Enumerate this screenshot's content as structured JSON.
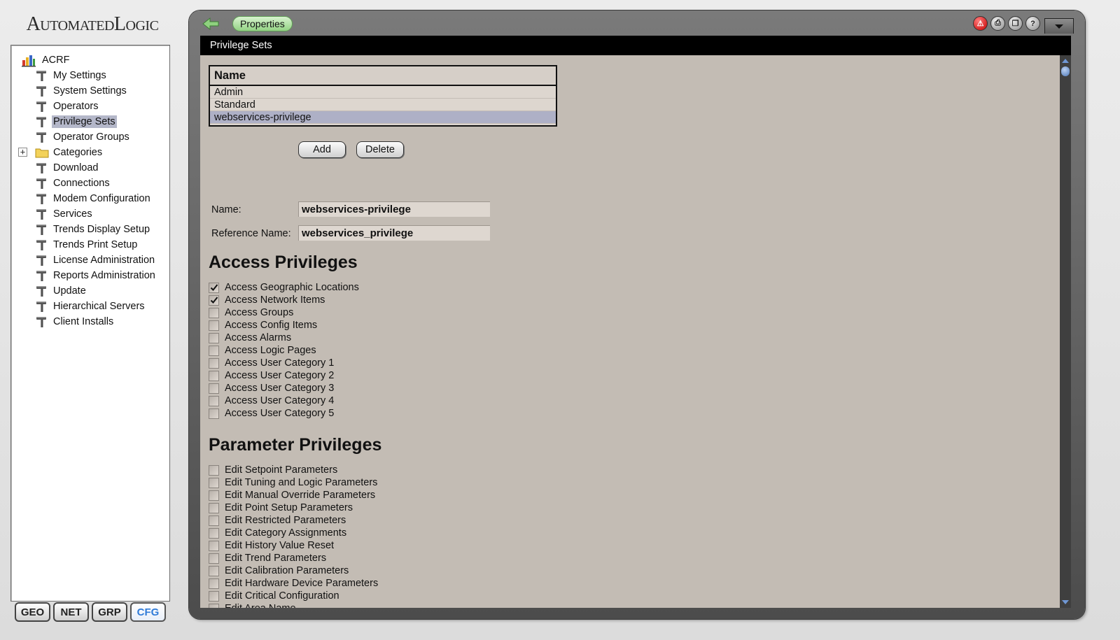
{
  "logo": "AutomatedLogic",
  "tree": {
    "root": "ACRF",
    "items": [
      {
        "label": "My Settings"
      },
      {
        "label": "System Settings"
      },
      {
        "label": "Operators"
      },
      {
        "label": "Privilege Sets",
        "selected": true
      },
      {
        "label": "Operator Groups"
      },
      {
        "label": "Categories",
        "folder": true,
        "expandable": true
      },
      {
        "label": "Download"
      },
      {
        "label": "Connections"
      },
      {
        "label": "Modem Configuration"
      },
      {
        "label": "Services"
      },
      {
        "label": "Trends Display Setup"
      },
      {
        "label": "Trends Print Setup"
      },
      {
        "label": "License Administration"
      },
      {
        "label": "Reports Administration"
      },
      {
        "label": "Update"
      },
      {
        "label": "Hierarchical Servers"
      },
      {
        "label": "Client Installs"
      }
    ]
  },
  "mode_buttons": [
    {
      "label": "GEO",
      "active": false
    },
    {
      "label": "NET",
      "active": false
    },
    {
      "label": "GRP",
      "active": false
    },
    {
      "label": "CFG",
      "active": true
    }
  ],
  "topbar": {
    "crumb": "Properties",
    "icons": [
      "alarm-icon",
      "print-icon",
      "window-icon",
      "help-icon"
    ]
  },
  "panel": {
    "title": "Privilege Sets",
    "table": {
      "header": "Name",
      "rows": [
        {
          "name": "Admin",
          "selected": false
        },
        {
          "name": "Standard",
          "selected": false
        },
        {
          "name": "webservices-privilege",
          "selected": true
        }
      ]
    },
    "add_label": "Add",
    "delete_label": "Delete",
    "name_label": "Name:",
    "name_value": "webservices-privilege",
    "ref_label": "Reference Name:",
    "ref_value": "webservices_privilege",
    "access_heading": "Access Privileges",
    "access_privileges": [
      {
        "label": "Access Geographic Locations",
        "checked": true
      },
      {
        "label": "Access Network Items",
        "checked": true
      },
      {
        "label": "Access Groups",
        "checked": false
      },
      {
        "label": "Access Config Items",
        "checked": false
      },
      {
        "label": "Access Alarms",
        "checked": false
      },
      {
        "label": "Access Logic Pages",
        "checked": false
      },
      {
        "label": "Access User Category 1",
        "checked": false
      },
      {
        "label": "Access User Category 2",
        "checked": false
      },
      {
        "label": "Access User Category 3",
        "checked": false
      },
      {
        "label": "Access User Category 4",
        "checked": false
      },
      {
        "label": "Access User Category 5",
        "checked": false
      }
    ],
    "param_heading": "Parameter Privileges",
    "parameter_privileges": [
      {
        "label": "Edit Setpoint Parameters",
        "checked": false
      },
      {
        "label": "Edit Tuning and Logic Parameters",
        "checked": false
      },
      {
        "label": "Edit Manual Override Parameters",
        "checked": false
      },
      {
        "label": "Edit Point Setup Parameters",
        "checked": false
      },
      {
        "label": "Edit Restricted Parameters",
        "checked": false
      },
      {
        "label": "Edit Category Assignments",
        "checked": false
      },
      {
        "label": "Edit History Value Reset",
        "checked": false
      },
      {
        "label": "Edit Trend Parameters",
        "checked": false
      },
      {
        "label": "Edit Calibration Parameters",
        "checked": false
      },
      {
        "label": "Edit Hardware Device Parameters",
        "checked": false
      },
      {
        "label": "Edit Critical Configuration",
        "checked": false
      },
      {
        "label": "Edit Area Name",
        "checked": false
      }
    ]
  },
  "colors": {
    "content_bg": "#c3bcb4",
    "selection": "#aeb0c6",
    "title_bar": "#000000",
    "crumb_green": "#92d283",
    "active_mode": "#2f7bd8"
  }
}
